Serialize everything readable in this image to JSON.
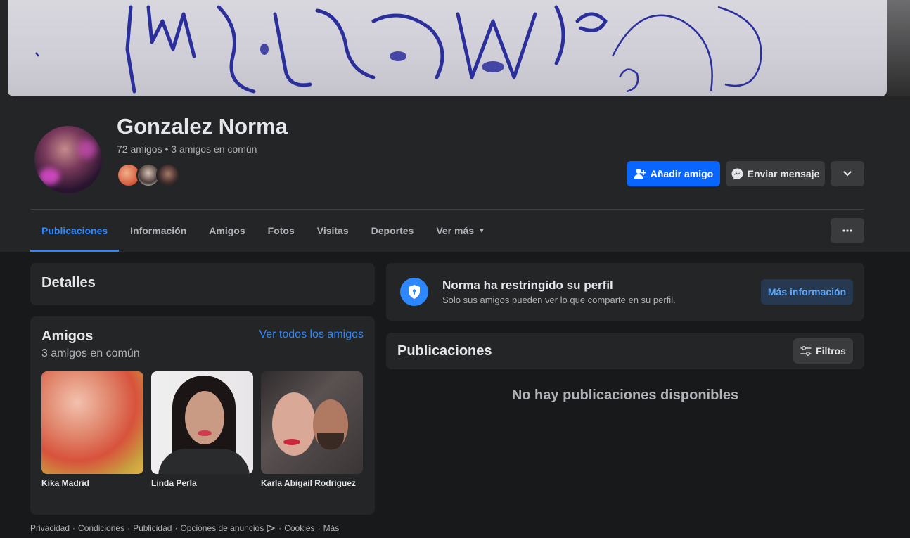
{
  "profile": {
    "name": "Gonzalez Norma",
    "friends_summary": "72 amigos • 3 amigos en común"
  },
  "actions": {
    "add_friend": "Añadir amigo",
    "send_message": "Enviar mensaje"
  },
  "tabs": [
    {
      "label": "Publicaciones",
      "active": true
    },
    {
      "label": "Información"
    },
    {
      "label": "Amigos"
    },
    {
      "label": "Fotos"
    },
    {
      "label": "Visitas"
    },
    {
      "label": "Deportes"
    },
    {
      "label": "Ver más"
    }
  ],
  "details": {
    "title": "Detalles"
  },
  "friends_card": {
    "title": "Amigos",
    "subtitle": "3 amigos en común",
    "see_all": "Ver todos los amigos",
    "friends": [
      {
        "name": "Kika Madrid"
      },
      {
        "name": "Linda Perla"
      },
      {
        "name": "Karla Abigail Rodríguez"
      }
    ]
  },
  "restricted": {
    "title": "Norma ha restringido su perfil",
    "text": "Solo sus amigos pueden ver lo que comparte en su perfil.",
    "button": "Más información"
  },
  "posts": {
    "title": "Publicaciones",
    "filter": "Filtros",
    "empty": "No hay publicaciones disponibles"
  },
  "footer": {
    "links": [
      "Privacidad",
      "Condiciones",
      "Publicidad",
      "Opciones de anuncios",
      "Cookies",
      "Más"
    ]
  },
  "colors": {
    "accent": "#0866ff",
    "link": "#2d88ff",
    "background": "#18191a",
    "surface": "#242526"
  }
}
